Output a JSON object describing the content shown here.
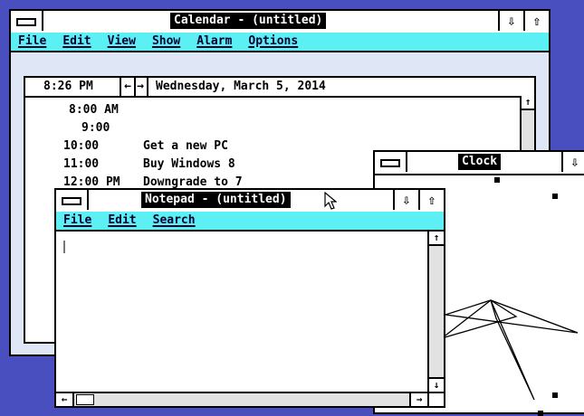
{
  "calendar": {
    "title": "Calendar - (untitled)",
    "menu": [
      "File",
      "Edit",
      "View",
      "Show",
      "Alarm",
      "Options"
    ],
    "current_time": "8:26 PM",
    "nav_prev": "←",
    "nav_next": "→",
    "date": "Wednesday, March 5, 2014",
    "appointments": [
      {
        "time": "8:00 AM",
        "text": ""
      },
      {
        "time": "9:00",
        "text": ""
      },
      {
        "time": "10:00",
        "text": "Get a new PC"
      },
      {
        "time": "11:00",
        "text": "Buy Windows 8"
      },
      {
        "time": "12:00 PM",
        "text": "Downgrade to 7"
      }
    ]
  },
  "notepad": {
    "title": "Notepad - (untitled)",
    "menu": [
      "File",
      "Edit",
      "Search"
    ],
    "content": ""
  },
  "clock": {
    "title": "Clock"
  },
  "controls": {
    "minimize": "⇩",
    "maximize": "⇧",
    "scroll_up": "↑",
    "scroll_down": "↓",
    "scroll_left": "←",
    "scroll_right": "→"
  }
}
